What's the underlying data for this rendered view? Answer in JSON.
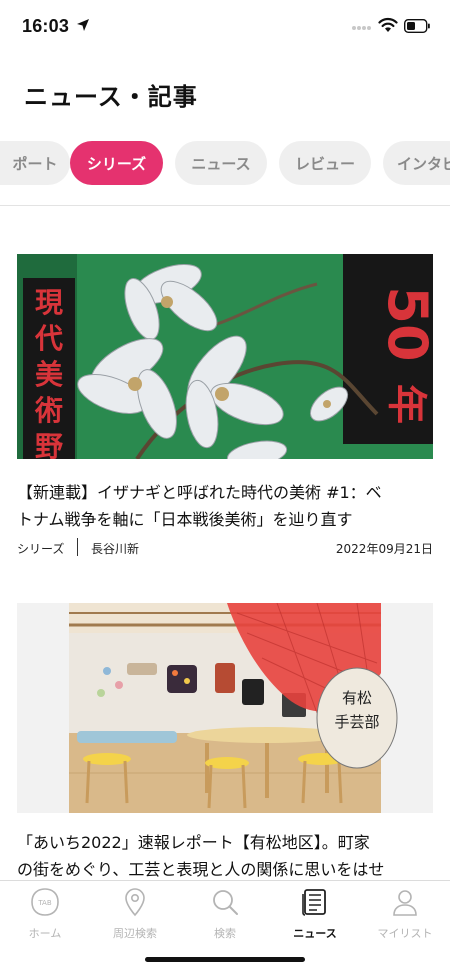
{
  "status_bar": {
    "time": "16:03"
  },
  "header": {
    "title": "ニュース・記事"
  },
  "tabs": [
    {
      "label": "ポート",
      "active": false
    },
    {
      "label": "シリーズ",
      "active": true
    },
    {
      "label": "ニュース",
      "active": false
    },
    {
      "label": "レビュー",
      "active": false
    },
    {
      "label": "インタビ",
      "active": false
    }
  ],
  "articles": [
    {
      "image_text_left": "現代美術野外",
      "image_text_right": "50年",
      "title_line1": "【新連載】イザナギと呼ばれた時代の美術 #1：ベ",
      "title_line2": "トナム戦争を軸に「日本戦後美術」を辿り直す",
      "category": "シリーズ",
      "author": "長谷川新",
      "date": "2022年09月21日"
    },
    {
      "image_text_sign": "有松 手芸部",
      "title_line1": "「あいち2022」速報レポート【有松地区】。町家",
      "title_line2": "の街をめぐり、工芸と表現と人の関係に思いをはせ"
    }
  ],
  "bottom_nav": [
    {
      "label": "ホーム",
      "icon": "tab-logo-icon",
      "active": false
    },
    {
      "label": "周辺検索",
      "icon": "map-pin-icon",
      "active": false
    },
    {
      "label": "検索",
      "icon": "search-icon",
      "active": false
    },
    {
      "label": "ニュース",
      "icon": "news-icon",
      "active": true
    },
    {
      "label": "マイリスト",
      "icon": "person-icon",
      "active": false
    }
  ],
  "colors": {
    "accent": "#e5326f",
    "tab_bg": "#efefef",
    "inactive_text": "#b4b4b4"
  }
}
